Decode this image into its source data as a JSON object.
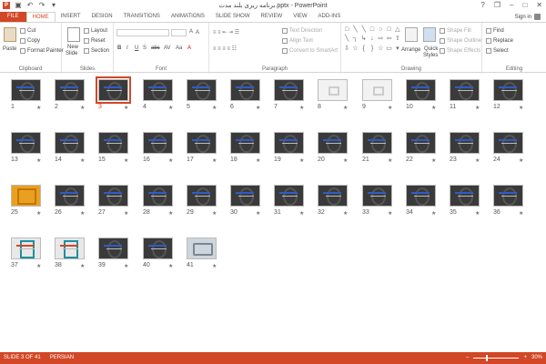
{
  "title": "برنامه ریزی بلند مدت.pptx - PowerPoint",
  "qat": {
    "undo_icon": "↶",
    "redo_icon": "↷",
    "save_icon": "▣",
    "customize": "▾"
  },
  "tabs": [
    "FILE",
    "HOME",
    "INSERT",
    "DESIGN",
    "TRANSITIONS",
    "ANIMATIONS",
    "SLIDE SHOW",
    "REVIEW",
    "VIEW",
    "ADD-INS"
  ],
  "active_tab": "HOME",
  "window_controls": {
    "help": "?",
    "restore": "❐",
    "minimize": "–",
    "maximize": "□",
    "close": "✕"
  },
  "signin": "Sign in",
  "ribbon": {
    "clipboard": {
      "paste": "Paste",
      "cut": "Cut",
      "copy": "Copy",
      "format_painter": "Format Painter",
      "label": "Clipboard"
    },
    "slides": {
      "new_slide": "New",
      "new_slide_2": "Slide",
      "layout": "Layout",
      "reset": "Reset",
      "section": "Section",
      "label": "Slides"
    },
    "font": {
      "label": "Font",
      "bold": "B",
      "italic": "I",
      "underline": "U",
      "shadow": "S",
      "strike": "abc",
      "spacing": "AV",
      "case": "Aa",
      "color": "A",
      "grow": "A",
      "shrink": "A"
    },
    "paragraph": {
      "label": "Paragraph",
      "text_direction": "Text Direction",
      "align_text": "Align Text",
      "convert_smartart": "Convert to SmartArt"
    },
    "drawing": {
      "label": "Drawing",
      "arrange": "Arrange",
      "quick_styles": "Quick",
      "quick_styles_2": "Styles",
      "shape_fill": "Shape Fill",
      "shape_outline": "Shape Outline",
      "shape_effects": "Shape Effects"
    },
    "editing": {
      "label": "Editing",
      "find": "Find",
      "replace": "Replace",
      "select": "Select"
    }
  },
  "slides": [
    {
      "n": "1",
      "kind": "dark"
    },
    {
      "n": "2",
      "kind": "dark"
    },
    {
      "n": "3",
      "kind": "dark",
      "selected": true
    },
    {
      "n": "4",
      "kind": "dark"
    },
    {
      "n": "5",
      "kind": "dark"
    },
    {
      "n": "6",
      "kind": "dark"
    },
    {
      "n": "7",
      "kind": "dark"
    },
    {
      "n": "8",
      "kind": "light"
    },
    {
      "n": "9",
      "kind": "light"
    },
    {
      "n": "10",
      "kind": "dark"
    },
    {
      "n": "11",
      "kind": "dark"
    },
    {
      "n": "12",
      "kind": "dark"
    },
    {
      "n": "13",
      "kind": "dark"
    },
    {
      "n": "14",
      "kind": "dark"
    },
    {
      "n": "15",
      "kind": "dark"
    },
    {
      "n": "16",
      "kind": "dark"
    },
    {
      "n": "17",
      "kind": "dark"
    },
    {
      "n": "18",
      "kind": "dark"
    },
    {
      "n": "19",
      "kind": "dark"
    },
    {
      "n": "20",
      "kind": "dark"
    },
    {
      "n": "21",
      "kind": "dark"
    },
    {
      "n": "22",
      "kind": "dark"
    },
    {
      "n": "23",
      "kind": "dark"
    },
    {
      "n": "24",
      "kind": "dark"
    },
    {
      "n": "25",
      "kind": "orange"
    },
    {
      "n": "26",
      "kind": "dark"
    },
    {
      "n": "27",
      "kind": "dark"
    },
    {
      "n": "28",
      "kind": "dark"
    },
    {
      "n": "29",
      "kind": "dark"
    },
    {
      "n": "30",
      "kind": "dark"
    },
    {
      "n": "31",
      "kind": "dark"
    },
    {
      "n": "32",
      "kind": "dark"
    },
    {
      "n": "33",
      "kind": "dark"
    },
    {
      "n": "34",
      "kind": "dark"
    },
    {
      "n": "35",
      "kind": "dark"
    },
    {
      "n": "36",
      "kind": "dark"
    },
    {
      "n": "37",
      "kind": "mixed"
    },
    {
      "n": "38",
      "kind": "mixed"
    },
    {
      "n": "39",
      "kind": "dark"
    },
    {
      "n": "40",
      "kind": "dark"
    },
    {
      "n": "41",
      "kind": "photo"
    }
  ],
  "star_glyph": "★",
  "status": {
    "slide": "SLIDE 3 OF 41",
    "language": "PERSIAN",
    "zoom": "30%",
    "zoom_minus": "–",
    "zoom_plus": "+",
    "zoom_level": 0.3
  },
  "colors": {
    "accent": "#d24726"
  }
}
